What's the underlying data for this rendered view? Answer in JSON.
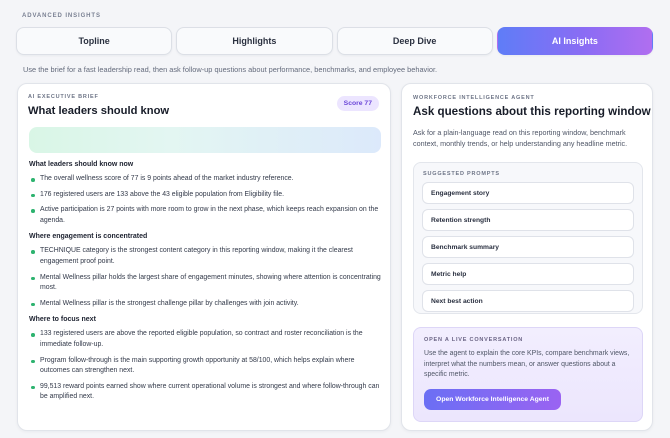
{
  "header": {
    "eyebrow": "ADVANCED INSIGHTS",
    "subtitle": "Use the brief for a fast leadership read, then ask follow-up questions about performance, benchmarks, and employee behavior."
  },
  "tabs": [
    {
      "label": "Topline",
      "active": false
    },
    {
      "label": "Highlights",
      "active": false
    },
    {
      "label": "Deep Dive",
      "active": false
    },
    {
      "label": "AI Insights",
      "active": true
    }
  ],
  "brief": {
    "label": "AI EXECUTIVE BRIEF",
    "title": "What leaders should know",
    "score_badge": "Score 77",
    "sections": [
      {
        "heading": "What leaders should know now",
        "items": [
          "The overall wellness score of 77 is 9 points ahead of the market industry reference.",
          "176 registered users are 133 above the 43 eligible population from Eligibility file.",
          "Active participation is 27 points with more room to grow in the next phase, which keeps reach expansion on the agenda."
        ]
      },
      {
        "heading": "Where engagement is concentrated",
        "items": [
          "TECHNIQUE category is the strongest content category in this reporting window, making it the clearest engagement proof point.",
          "Mental Wellness pillar holds the largest share of engagement minutes, showing where attention is concentrating most.",
          "Mental Wellness pillar is the strongest challenge pillar by challenges with join activity."
        ]
      },
      {
        "heading": "Where to focus next",
        "items": [
          "133 registered users are above the reported eligible population, so contract and roster reconciliation is the immediate follow-up.",
          "Program follow-through is the main supporting growth opportunity at 58/100, which helps explain where outcomes can strengthen next.",
          "99,513 reward points earned show where current operational volume is strongest and where follow-through can be amplified next."
        ]
      }
    ],
    "colors": {
      "bullet": "#2db36f",
      "badge_bg": "#ece5ff",
      "badge_text": "#6b46d8"
    }
  },
  "agent": {
    "label": "WORKFORCE INTELLIGENCE AGENT",
    "title": "Ask questions about this reporting window",
    "description": "Ask for a plain-language read on this reporting window, benchmark context, monthly trends, or help understanding any headline metric.",
    "prompts_label": "SUGGESTED PROMPTS",
    "prompts": [
      "Engagement story",
      "Retention strength",
      "Benchmark summary",
      "Metric help",
      "Next best action"
    ],
    "live": {
      "label": "OPEN A LIVE CONVERSATION",
      "description": "Use the agent to explain the core KPIs, compare benchmark views, interpret what the numbers mean, or answer questions about a specific metric.",
      "cta_label": "Open Workforce Intelligence Agent"
    }
  },
  "theme": {
    "accent_start": "#5f7df7",
    "accent_end": "#b06ef0",
    "background": "#f4f5f8"
  }
}
